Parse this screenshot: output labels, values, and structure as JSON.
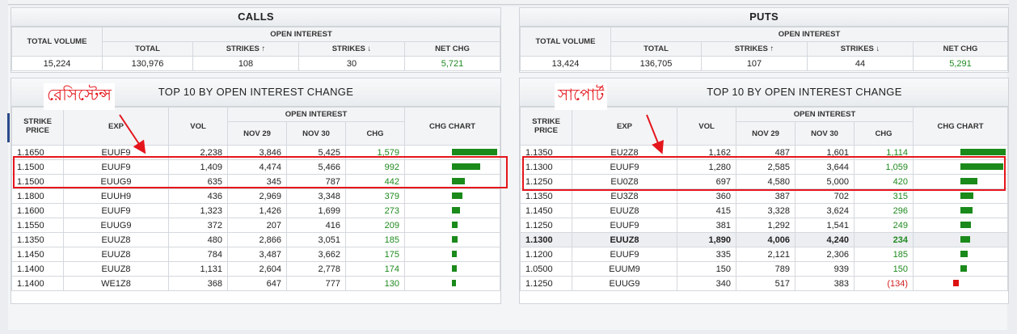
{
  "calls": {
    "title": "CALLS",
    "hdr_total_volume": "TOTAL VOLUME",
    "hdr_open_interest": "OPEN INTEREST",
    "hdr_total": "TOTAL",
    "hdr_strikes_up": "STRIKES ↑",
    "hdr_strikes_down": "STRIKES ↓",
    "hdr_net_chg": "NET CHG",
    "total_volume": "15,224",
    "total": "130,976",
    "strikes_up": "108",
    "strikes_down": "30",
    "net_chg": "5,721"
  },
  "puts": {
    "title": "PUTS",
    "hdr_total_volume": "TOTAL VOLUME",
    "hdr_open_interest": "OPEN INTEREST",
    "hdr_total": "TOTAL",
    "hdr_strikes_up": "STRIKES ↑",
    "hdr_strikes_down": "STRIKES ↓",
    "hdr_net_chg": "NET CHG",
    "total_volume": "13,424",
    "total": "136,705",
    "strikes_up": "107",
    "strikes_down": "44",
    "net_chg": "5,291"
  },
  "top10_headers": {
    "strike_price": "STRIKE PRICE",
    "exp": "EXP",
    "vol": "VOL",
    "open_interest": "OPEN INTEREST",
    "nov29": "NOV 29",
    "nov30": "NOV 30",
    "chg": "CHG",
    "chg_chart": "CHG CHART"
  },
  "calls_top10": {
    "title": "TOP 10 BY OPEN INTEREST CHANGE",
    "annotation": "রেসিস্টেন্স",
    "rows": [
      {
        "strike": "1.1650",
        "exp": "EUUF9",
        "vol": "2,238",
        "nov29": "3,846",
        "nov30": "5,425",
        "chg": "1,579",
        "chg_value": 1579
      },
      {
        "strike": "1.1500",
        "exp": "EUUF9",
        "vol": "1,409",
        "nov29": "4,474",
        "nov30": "5,466",
        "chg": "992",
        "chg_value": 992
      },
      {
        "strike": "1.1500",
        "exp": "EUUG9",
        "vol": "635",
        "nov29": "345",
        "nov30": "787",
        "chg": "442",
        "chg_value": 442
      },
      {
        "strike": "1.1800",
        "exp": "EUUH9",
        "vol": "436",
        "nov29": "2,969",
        "nov30": "3,348",
        "chg": "379",
        "chg_value": 379
      },
      {
        "strike": "1.1600",
        "exp": "EUUF9",
        "vol": "1,323",
        "nov29": "1,426",
        "nov30": "1,699",
        "chg": "273",
        "chg_value": 273
      },
      {
        "strike": "1.1550",
        "exp": "EUUG9",
        "vol": "372",
        "nov29": "207",
        "nov30": "416",
        "chg": "209",
        "chg_value": 209
      },
      {
        "strike": "1.1350",
        "exp": "EUUZ8",
        "vol": "480",
        "nov29": "2,866",
        "nov30": "3,051",
        "chg": "185",
        "chg_value": 185
      },
      {
        "strike": "1.1450",
        "exp": "EUUZ8",
        "vol": "784",
        "nov29": "3,487",
        "nov30": "3,662",
        "chg": "175",
        "chg_value": 175
      },
      {
        "strike": "1.1400",
        "exp": "EUUZ8",
        "vol": "1,131",
        "nov29": "2,604",
        "nov30": "2,778",
        "chg": "174",
        "chg_value": 174
      },
      {
        "strike": "1.1400",
        "exp": "WE1Z8",
        "vol": "368",
        "nov29": "647",
        "nov30": "777",
        "chg": "130",
        "chg_value": 130
      }
    ]
  },
  "puts_top10": {
    "title": "TOP 10 BY OPEN INTEREST CHANGE",
    "annotation": "সাপোর্ট",
    "rows": [
      {
        "strike": "1.1350",
        "exp": "EU2Z8",
        "vol": "1,162",
        "nov29": "487",
        "nov30": "1,601",
        "chg": "1,114",
        "chg_value": 1114
      },
      {
        "strike": "1.1300",
        "exp": "EUUF9",
        "vol": "1,280",
        "nov29": "2,585",
        "nov30": "3,644",
        "chg": "1,059",
        "chg_value": 1059
      },
      {
        "strike": "1.1250",
        "exp": "EU0Z8",
        "vol": "697",
        "nov29": "4,580",
        "nov30": "5,000",
        "chg": "420",
        "chg_value": 420
      },
      {
        "strike": "1.1350",
        "exp": "EU3Z8",
        "vol": "360",
        "nov29": "387",
        "nov30": "702",
        "chg": "315",
        "chg_value": 315
      },
      {
        "strike": "1.1450",
        "exp": "EUUZ8",
        "vol": "415",
        "nov29": "3,328",
        "nov30": "3,624",
        "chg": "296",
        "chg_value": 296
      },
      {
        "strike": "1.1250",
        "exp": "EUUF9",
        "vol": "381",
        "nov29": "1,292",
        "nov30": "1,541",
        "chg": "249",
        "chg_value": 249
      },
      {
        "strike": "1.1300",
        "exp": "EUUZ8",
        "vol": "1,890",
        "nov29": "4,006",
        "nov30": "4,240",
        "chg": "234",
        "chg_value": 234,
        "highlight": true
      },
      {
        "strike": "1.1200",
        "exp": "EUUF9",
        "vol": "335",
        "nov29": "2,121",
        "nov30": "2,306",
        "chg": "185",
        "chg_value": 185
      },
      {
        "strike": "1.0500",
        "exp": "EUUM9",
        "vol": "150",
        "nov29": "789",
        "nov30": "939",
        "chg": "150",
        "chg_value": 150
      },
      {
        "strike": "1.1250",
        "exp": "EUUG9",
        "vol": "340",
        "nov29": "517",
        "nov30": "383",
        "chg": "(134)",
        "chg_value": -134
      }
    ]
  },
  "colors": {
    "positive": "#1a8a1a",
    "negative": "#dd1111",
    "annotation": "#e4161c"
  }
}
